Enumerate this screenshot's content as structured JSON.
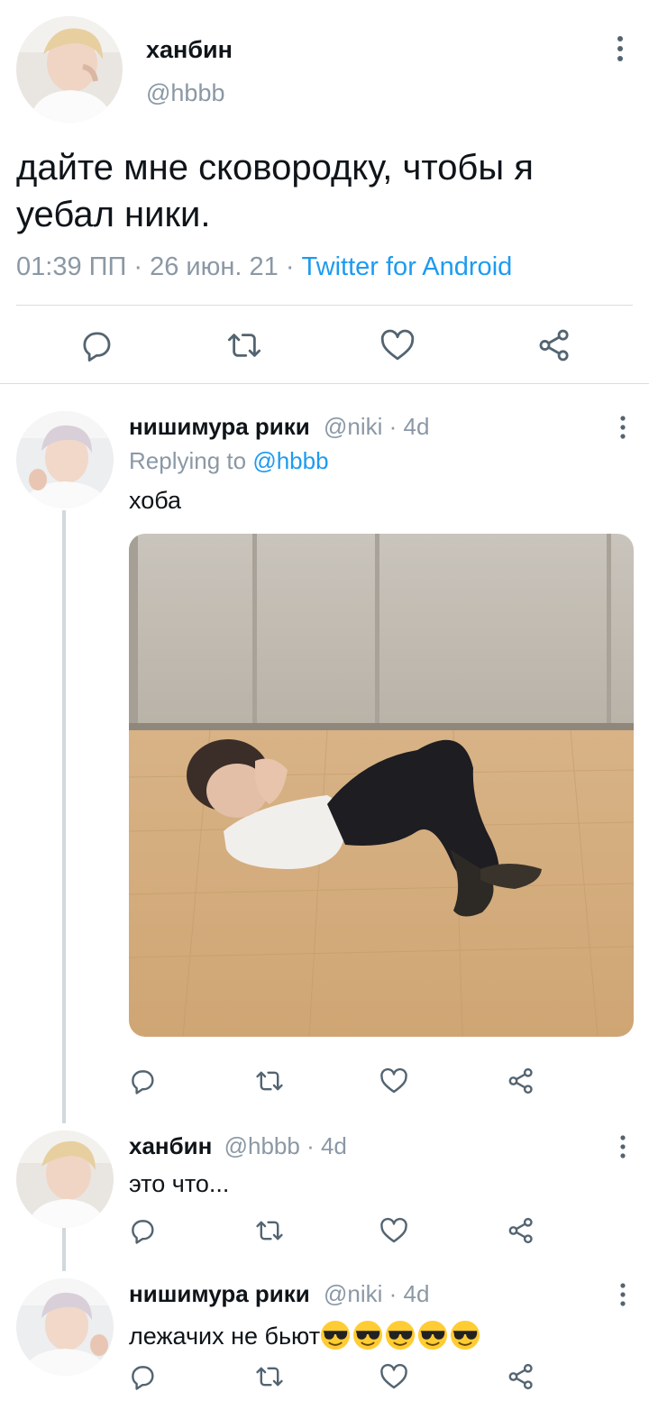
{
  "main_tweet": {
    "display_name": "ханбин",
    "handle": "@hbbb",
    "text": "дайте мне сковородку, чтобы я уебал ники.",
    "time": "01:39 ПП",
    "date": "26 июн. 21",
    "source": "Twitter for Android"
  },
  "replies": [
    {
      "display_name": "нишимура рики",
      "handle": "@niki",
      "age": "4d",
      "replying_label": "Replying to",
      "replying_to": "@hbbb",
      "text": "хоба",
      "has_media": true
    },
    {
      "display_name": "ханбин",
      "handle": "@hbbb",
      "age": "4d",
      "text": "это что..."
    },
    {
      "display_name": "нишимура рики",
      "handle": "@niki",
      "age": "4d",
      "text": "лежачих не бьют",
      "emoji": [
        "smiling-face-with-sunglasses",
        "smiling-face-with-sunglasses",
        "smiling-face-with-sunglasses",
        "smiling-face-with-sunglasses",
        "smiling-face-with-sunglasses"
      ]
    }
  ],
  "icons": {
    "more": "more-vertical-icon",
    "reply": "reply-icon",
    "retweet": "retweet-icon",
    "like": "like-icon",
    "share": "share-icon"
  },
  "colors": {
    "accent": "#1d9bf0",
    "secondary_text": "#8b98a5",
    "icon": "#536471",
    "thread_line": "#cfd9de"
  }
}
